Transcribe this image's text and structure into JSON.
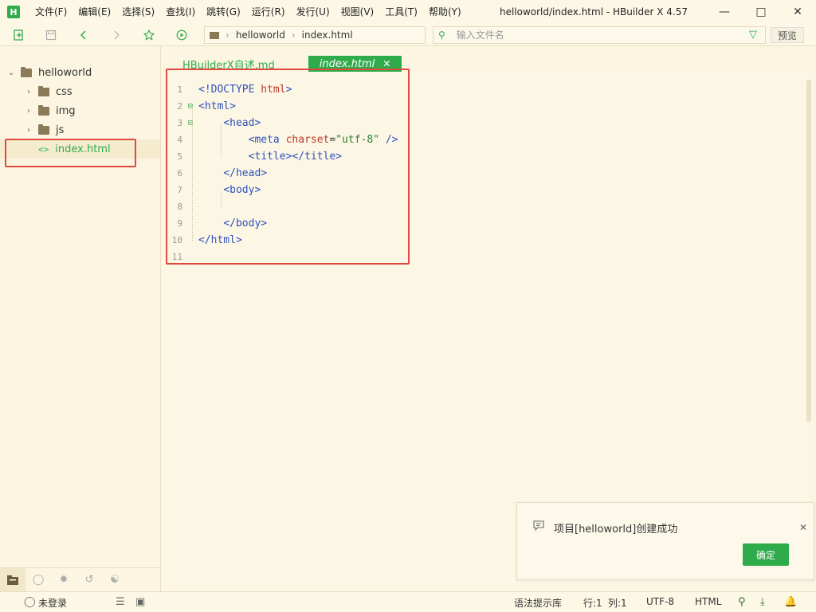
{
  "window": {
    "app_logo": "H",
    "title": "helloworld/index.html - HBuilder X 4.57",
    "menu": [
      "文件(F)",
      "编辑(E)",
      "选择(S)",
      "查找(I)",
      "跳转(G)",
      "运行(R)",
      "发行(U)",
      "视图(V)",
      "工具(T)",
      "帮助(Y)"
    ]
  },
  "toolbar": {
    "breadcrumb": [
      "helloworld",
      "index.html"
    ],
    "search_placeholder": "输入文件名",
    "preview_label": "预览"
  },
  "sidebar": {
    "project": "helloworld",
    "items": [
      {
        "label": "css",
        "type": "folder"
      },
      {
        "label": "img",
        "type": "folder"
      },
      {
        "label": "js",
        "type": "folder"
      },
      {
        "label": "index.html",
        "type": "html",
        "selected": true
      }
    ]
  },
  "tabs": [
    {
      "label": "HBuilderX自述.md",
      "active": false
    },
    {
      "label": "index.html",
      "active": true
    }
  ],
  "code_lines": [
    {
      "n": "1",
      "fold": ""
    },
    {
      "n": "2",
      "fold": "⊟"
    },
    {
      "n": "3",
      "fold": "⊟"
    },
    {
      "n": "4",
      "fold": ""
    },
    {
      "n": "5",
      "fold": ""
    },
    {
      "n": "6",
      "fold": ""
    },
    {
      "n": "7",
      "fold": ""
    },
    {
      "n": "8",
      "fold": ""
    },
    {
      "n": "9",
      "fold": ""
    },
    {
      "n": "10",
      "fold": ""
    },
    {
      "n": "11",
      "fold": ""
    }
  ],
  "code": {
    "l1_a": "<!DOCTYPE ",
    "l1_b": "html",
    "l1_c": ">",
    "l2": "<html>",
    "l3": "<head>",
    "l4_a": "<meta ",
    "l4_b": "charset",
    "l4_c": "=",
    "l4_d": "\"utf-8\"",
    "l4_e": " />",
    "l5": "<title></title>",
    "l6": "</head>",
    "l7": "<body>",
    "l9": "</body>",
    "l10": "</html>"
  },
  "notification": {
    "message": "项目[helloworld]创建成功",
    "ok_label": "确定"
  },
  "status": {
    "login": "未登录",
    "syntax_hint": "语法提示库",
    "row": "行:1",
    "col": "列:1",
    "encoding": "UTF-8",
    "language": "HTML"
  },
  "colors": {
    "accent": "#2fab4c",
    "highlight_box": "#e2483e",
    "background": "#fbf5e2"
  }
}
